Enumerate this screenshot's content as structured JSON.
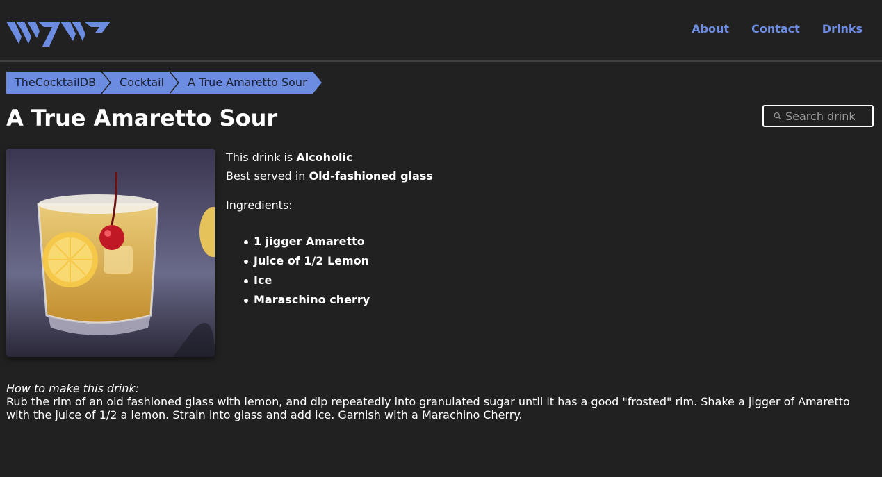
{
  "nav": {
    "about": "About",
    "contact": "Contact",
    "drinks": "Drinks"
  },
  "breadcrumb": [
    "TheCocktailDB",
    "Cocktail",
    "A True Amaretto Sour"
  ],
  "drink": {
    "title": "A True Amaretto Sour",
    "alcoholic_prefix": "This drink is ",
    "alcoholic": "Alcoholic",
    "glass_prefix": "Best served in ",
    "glass": "Old-fashioned glass",
    "ingredients_label": "Ingredients:",
    "ingredients": [
      "1 jigger Amaretto",
      "Juice of 1/2 Lemon",
      "Ice",
      "Maraschino cherry"
    ],
    "howto_label": "How to make this drink:",
    "instructions": "Rub the rim of an old fashioned glass with lemon, and dip repeatedly into granulated sugar until it has a good \"frosted\" rim. Shake a jigger of Amaretto with the juice of 1/2 a lemon. Strain into glass and add ice. Garnish with a Marachino Cherry."
  },
  "search": {
    "placeholder": "Search drink"
  },
  "colors": {
    "accent": "#6b8ce0",
    "background": "#212121"
  },
  "icons": {
    "search": "search-icon",
    "logo": "logo-icon"
  }
}
